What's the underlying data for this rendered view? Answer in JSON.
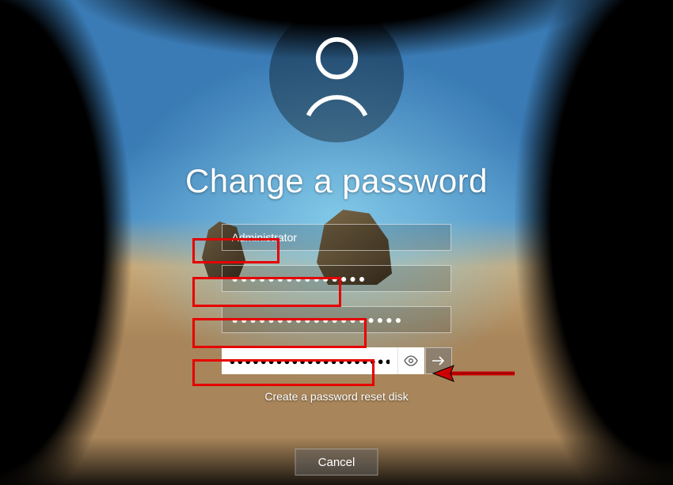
{
  "title": "Change a password",
  "username": {
    "value": "Administrator"
  },
  "old_password": {
    "masked": "●●●●●●●●●●●●●●●"
  },
  "new_password": {
    "masked": "●●●●●●●●●●●●●●●●●●●"
  },
  "confirm_password": {
    "masked": "●●●●●●●●●●●●●●●●●●●●●●●"
  },
  "reset_link": "Create a password reset disk",
  "cancel_label": "Cancel",
  "icons": {
    "avatar": "person-icon",
    "reveal": "eye-icon",
    "submit": "arrow-right-icon"
  },
  "annotations": {
    "highlight_color": "#e60000",
    "arrow_color": "#e60000"
  }
}
